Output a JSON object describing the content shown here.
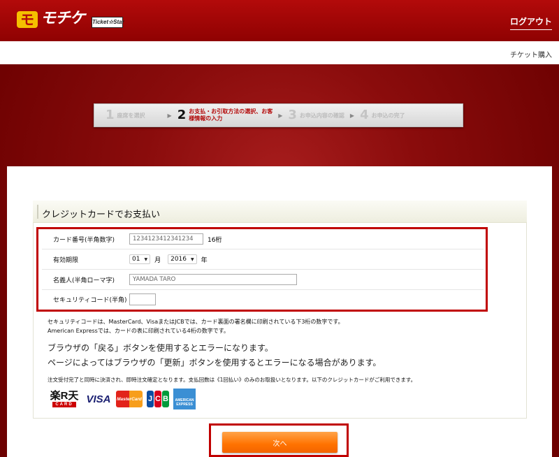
{
  "header": {
    "logo_text": "モチケ",
    "badge_text": "Ticket☆Star",
    "logout_label": "ログアウト"
  },
  "subbar": {
    "label": "チケット購入"
  },
  "steps": [
    {
      "num": "1",
      "label": "座席を選択"
    },
    {
      "num": "2",
      "label": "お支払・お引取方法の選択、お客様情報の入力"
    },
    {
      "num": "3",
      "label": "お申込内容の確認"
    },
    {
      "num": "4",
      "label": "お申込の完了"
    }
  ],
  "card": {
    "title": "クレジットカードでお支払い",
    "card_number_label": "カード番号(半角数字)",
    "card_number_value": "1234123412341234",
    "card_number_suffix": "16桁",
    "expiry_label": "有効期限",
    "expiry_month": "01",
    "expiry_month_unit": "月",
    "expiry_year": "2016",
    "expiry_year_unit": "年",
    "name_label": "名義人(半角ローマ字)",
    "name_value": "YAMADA TARO",
    "security_label": "セキュリティコード(半角)",
    "security_value": ""
  },
  "notes": {
    "security_note_1": "セキュリティコードは、MasterCard、VisaまたはJCBでは、カード裏面の署名欄に印刷されている下3桁の数字です。",
    "security_note_2": "American Expressでは、カードの表に印刷されている4桁の数字です。",
    "warning_1": "ブラウザの「戻る」ボタンを使用するとエラーになります。",
    "warning_2": "ページによってはブラウザの「更新」ボタンを使用するとエラーになる場合があります。",
    "payment_note": "注文受付完了と同時に決済され、即時注文確定となります。支払回数は《1回払い》のみのお取扱いとなります。以下のクレジットカードがご利用できます。"
  },
  "brands": {
    "rakuten": "楽R天",
    "rakuten_sub": "CARD",
    "visa": "VISA",
    "mastercard": "MasterCard",
    "jcb": [
      "J",
      "C",
      "B"
    ],
    "amex": "AMERICAN EXPRESS"
  },
  "next_button": {
    "label": "次へ"
  }
}
